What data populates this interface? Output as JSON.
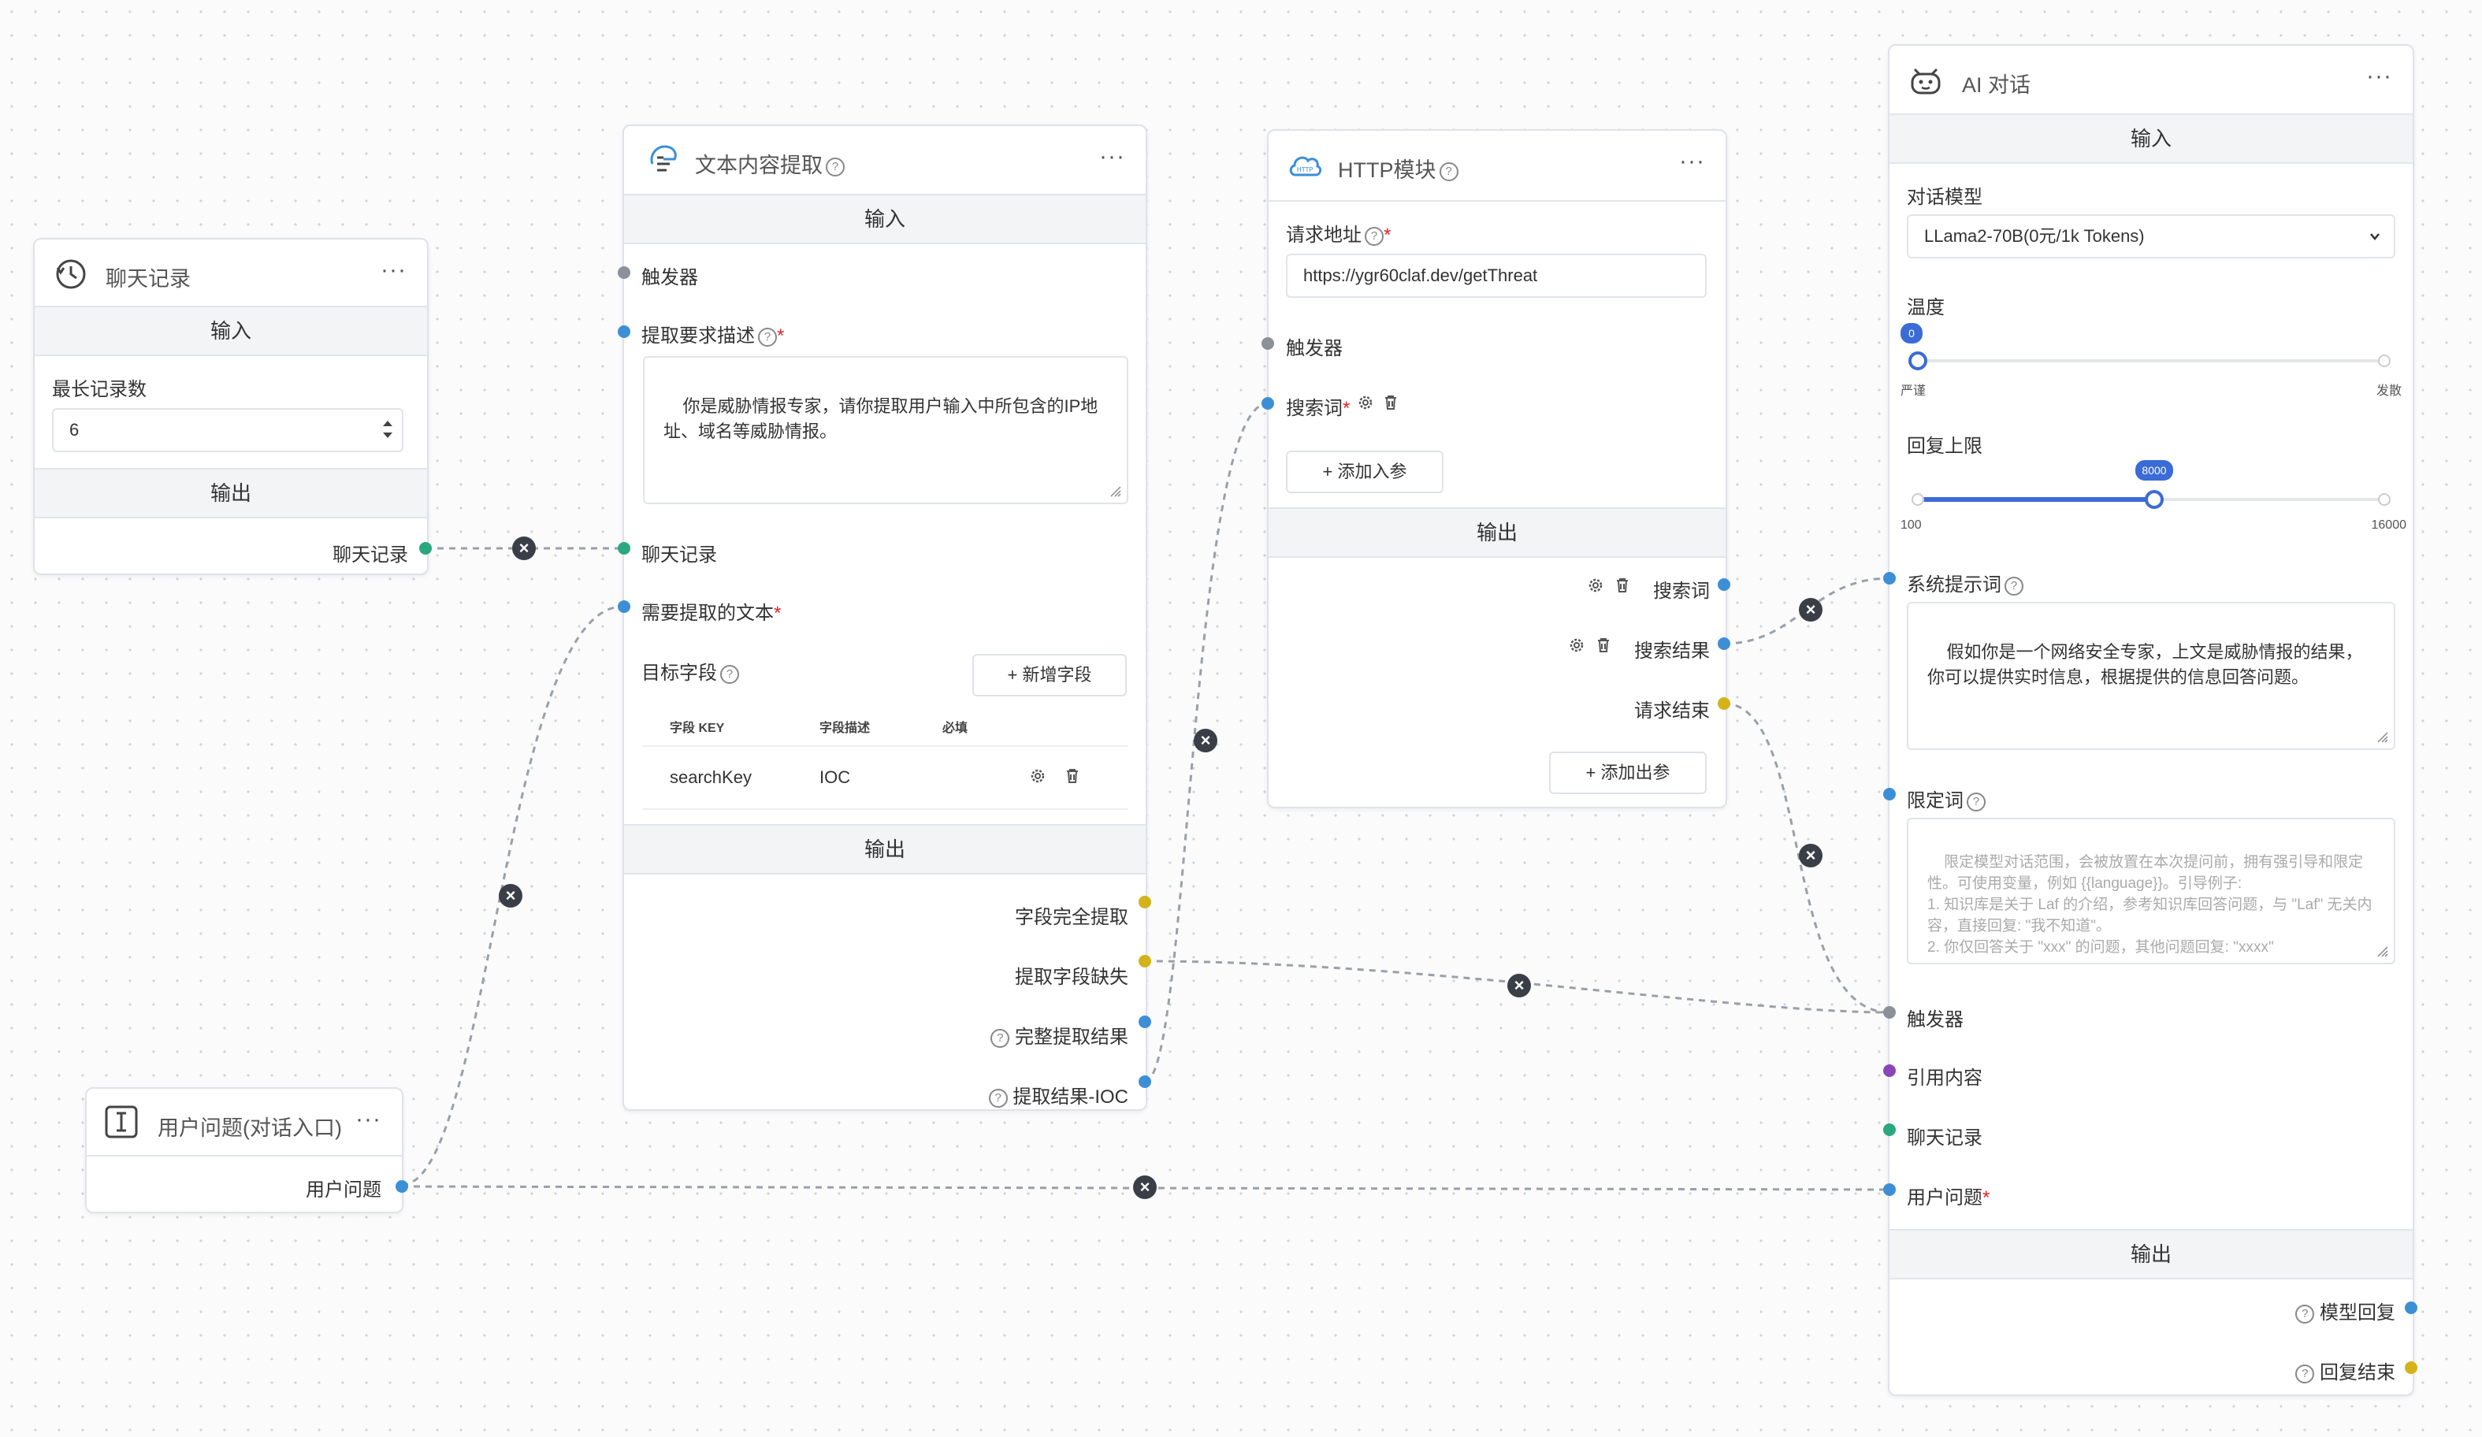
{
  "chat_history_node": {
    "title": "聊天记录",
    "menu": "···",
    "input_section": "输入",
    "max_records_label": "最长记录数",
    "max_records_value": "6",
    "output_section": "输出",
    "output_label": "聊天记录"
  },
  "user_question_node": {
    "title": "用户问题(对话入口)",
    "menu": "···",
    "output_label": "用户问题"
  },
  "text_extract_node": {
    "title": "文本内容提取",
    "menu": "···",
    "input_section": "输入",
    "trigger_label": "触发器",
    "requirement_label": "提取要求描述",
    "requirement_text": "你是威胁情报专家，请你提取用户输入中所包含的IP地址、域名等威胁情报。",
    "history_label": "聊天记录",
    "source_text_label": "需要提取的文本",
    "target_field_label": "目标字段",
    "add_field_button": "新增字段",
    "table_headers": [
      "字段 KEY",
      "字段描述",
      "必填"
    ],
    "table_rows": [
      {
        "key": "searchKey",
        "desc": "IOC"
      }
    ],
    "output_section": "输出",
    "outputs": [
      "字段完全提取",
      "提取字段缺失",
      "完整提取结果",
      "提取结果-IOC"
    ]
  },
  "http_node": {
    "title": "HTTP模块",
    "menu": "···",
    "url_label": "请求地址",
    "url_value": "https://ygr60claf.dev/getThreat",
    "trigger_label": "触发器",
    "search_param_label": "搜索词",
    "add_input_button": "添加入参",
    "output_section": "输出",
    "outputs": [
      "搜索词",
      "搜索结果",
      "请求结束"
    ],
    "add_output_button": "添加出参"
  },
  "ai_chat_node": {
    "title": "AI 对话",
    "menu": "···",
    "input_section": "输入",
    "model_label": "对话模型",
    "model_value": "LLama2-70B(0元/1k Tokens)",
    "temperature_label": "温度",
    "temperature_value": "0",
    "temperature_value_fraction": 0,
    "temperature_min_label": "严谨",
    "temperature_max_label": "发散",
    "max_reply_label": "回复上限",
    "max_reply_value": "8000",
    "max_reply_value_fraction": 0.5,
    "max_reply_min": "100",
    "max_reply_max": "16000",
    "system_prompt_label": "系统提示词",
    "system_prompt_text": "假如你是一个网络安全专家，上文是威胁情报的结果，你可以提供实时信息，根据提供的信息回答问题。",
    "limit_label": "限定词",
    "limit_placeholder": "限定模型对话范围，会被放置在本次提问前，拥有强引导和限定性。可使用变量，例如 {{language}}。引导例子:\n1. 知识库是关于 Laf 的介绍，参考知识库回答问题，与 \"Laf\" 无关内容，直接回复: \"我不知道\"。\n2. 你仅回答关于 \"xxx\" 的问题，其他问题回复: \"xxxx\"",
    "trigger_label": "触发器",
    "quote_label": "引用内容",
    "history_label": "聊天记录",
    "user_question_label": "用户问题",
    "output_section": "输出",
    "outputs": [
      "模型回复",
      "回复结束"
    ]
  },
  "colors": {
    "blue": "#3c8fd6",
    "green": "#2aa87d",
    "yellow": "#d4b21a",
    "gray": "#8c9199",
    "purple": "#8a45b8",
    "accent": "#3b6bd6"
  }
}
